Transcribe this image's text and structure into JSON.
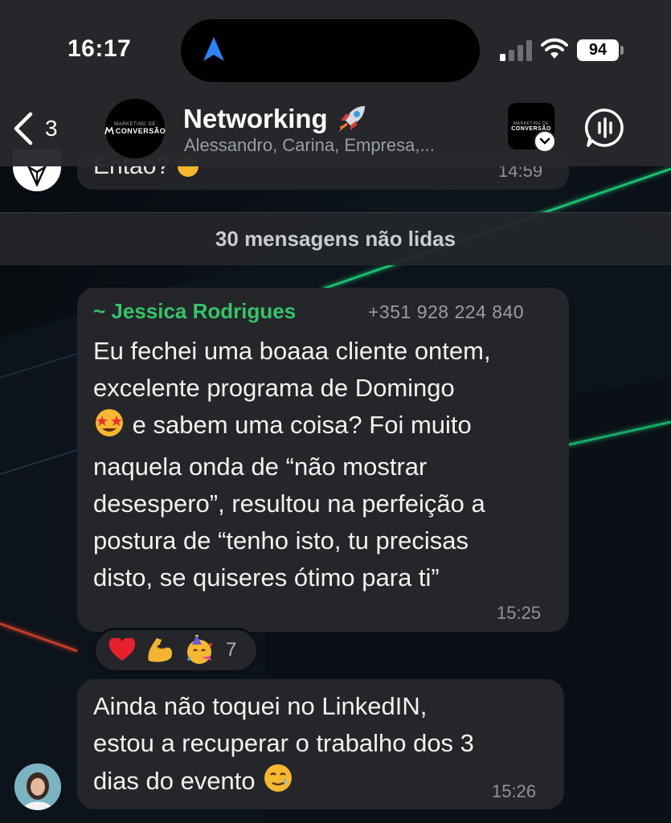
{
  "status_bar": {
    "time": "16:17",
    "battery": "94",
    "icons": [
      "location-arrow-icon",
      "signal-icon",
      "wifi-icon",
      "battery-icon"
    ]
  },
  "header": {
    "back_count": "3",
    "group_name": "Networking",
    "group_emoji": "rocket-icon",
    "members": "Alessandro, Carina, Empresa,...",
    "avatar_logo_small": "MARKETING DE",
    "avatar_logo_big": "CONVERSÃO",
    "call_icon": "voice-call-icon"
  },
  "previous_message": {
    "text_fragment": "Então? ",
    "time": "14:59"
  },
  "unread_divider": "30 mensagens não lidas",
  "messages": [
    {
      "sender": "~ Jessica Rodrigues",
      "phone": "+351 928 224 840",
      "lines": [
        "Eu fechei uma boaaa cliente ontem,",
        "excelente programa de Domingo",
        " e sabem uma coisa? Foi muito",
        "naquela onda de “não mostrar",
        "desespero”, resultou na perfeição a",
        "postura de “tenho isto, tu precisas",
        "disto, se quiseres ótimo para ti”"
      ],
      "time": "15:25",
      "reactions": {
        "emojis": [
          "heart-emoji",
          "flexed-biceps-emoji",
          "party-face-emoji"
        ],
        "count": "7"
      }
    },
    {
      "lines": [
        "Ainda não toquei no LinkedIN,",
        "estou a recuperar o trabalho dos 3",
        "dias do evento "
      ],
      "time": "15:26"
    }
  ],
  "colors": {
    "header_bg": "#26282b",
    "bubble_bg": "#242629",
    "sender_name": "#35c46a",
    "meta_text": "#8f9398"
  }
}
